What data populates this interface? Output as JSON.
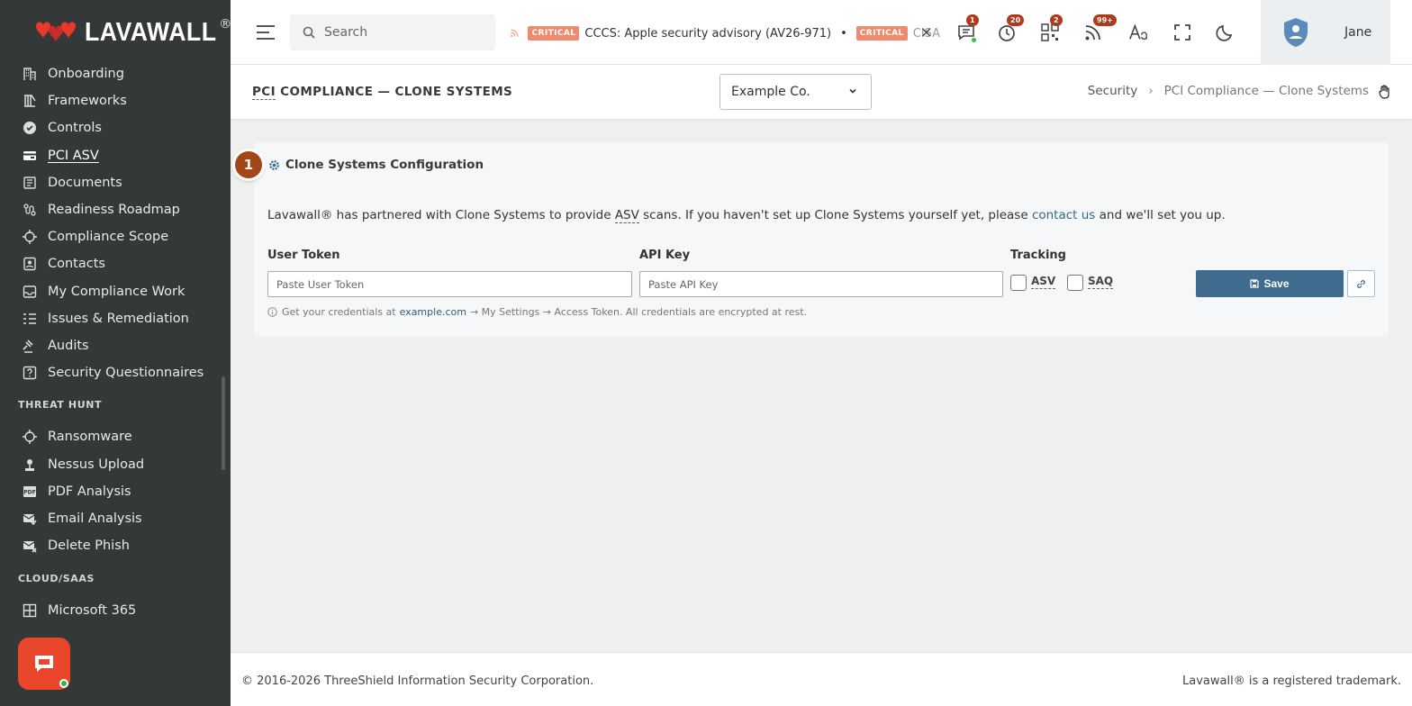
{
  "brand": {
    "name": "LAVAWALL",
    "reg": "®"
  },
  "sidebar": {
    "items": [
      {
        "label": "Onboarding",
        "icon": "building-icon"
      },
      {
        "label": "Frameworks",
        "icon": "bank-icon"
      },
      {
        "label": "Controls",
        "icon": "check-badge-icon"
      },
      {
        "label": "PCI ASV",
        "icon": "credit-card-icon",
        "active": true
      },
      {
        "label": "Documents",
        "icon": "documents-icon"
      },
      {
        "label": "Readiness Roadmap",
        "icon": "route-icon"
      },
      {
        "label": "Compliance Scope",
        "icon": "crosshair-icon"
      },
      {
        "label": "Contacts",
        "icon": "contact-card-icon"
      },
      {
        "label": "My Compliance Work",
        "icon": "inbox-icon"
      },
      {
        "label": "Issues & Remediation",
        "icon": "list-check-icon"
      },
      {
        "label": "Audits",
        "icon": "gavel-icon"
      },
      {
        "label": "Security Questionnaires",
        "icon": "question-square-icon"
      }
    ],
    "section_threat": "THREAT HUNT",
    "threat_items": [
      {
        "label": "Ransomware",
        "icon": "crosshair-icon"
      },
      {
        "label": "Nessus Upload",
        "icon": "upload-icon"
      },
      {
        "label": "PDF Analysis",
        "icon": "pdf-icon"
      },
      {
        "label": "Email Analysis",
        "icon": "mail-check-icon"
      },
      {
        "label": "Delete Phish",
        "icon": "mail-x-icon"
      }
    ],
    "section_cloud": "CLOUD/SAAS",
    "cloud_items": [
      {
        "label": "Microsoft 365",
        "icon": "windows-grid-icon"
      }
    ]
  },
  "topbar": {
    "search_placeholder": "Search",
    "ticker": [
      {
        "badge": "CRITICAL",
        "text": "CCCS: Apple security advisory (AV26-971)"
      },
      {
        "badge": "CRITICAL",
        "text": "CISA"
      }
    ],
    "ticker_sep": "•",
    "close": "×",
    "counts": {
      "messages": "1",
      "timer": "20",
      "qr": "2",
      "feed": "99+"
    },
    "user_name": "Jane"
  },
  "page": {
    "title_abbr": "PCI",
    "title_rest": " COMPLIANCE — CLONE SYSTEMS",
    "company": "Example Co.",
    "breadcrumb_root": "Security",
    "breadcrumb_sep": "›",
    "breadcrumb_current": "PCI Compliance — Clone Systems"
  },
  "card": {
    "step": "1",
    "title": "Clone Systems Configuration",
    "desc_1": "Lavawall® has partnered with Clone Systems to provide ",
    "desc_asv": "ASV",
    "desc_2": " scans. If you haven't set up Clone Systems yourself yet, please ",
    "desc_link": "contact us",
    "desc_3": " and we'll set you up.",
    "user_token_label": "User Token",
    "user_token_placeholder": "Paste User Token",
    "api_key_label": "API Key",
    "api_key_placeholder": "Paste API Key",
    "tracking_label": "Tracking",
    "asv_label": "ASV",
    "saq_label": "SAQ",
    "save_label": "Save",
    "help_1": "Get your credentials at",
    "help_domain": "example.com",
    "help_2": "→ My Settings → Access Token. All credentials are encrypted at rest."
  },
  "footer": {
    "copyright": "© 2016-2026 ThreeShield Information Security Corporation.",
    "trademark": "Lavawall® is a registered trademark."
  },
  "colors": {
    "sidebar": "#353839",
    "accent": "#3f6b8e",
    "critical": "#f08a6c",
    "chat": "#e8472b",
    "step": "#a34718"
  }
}
